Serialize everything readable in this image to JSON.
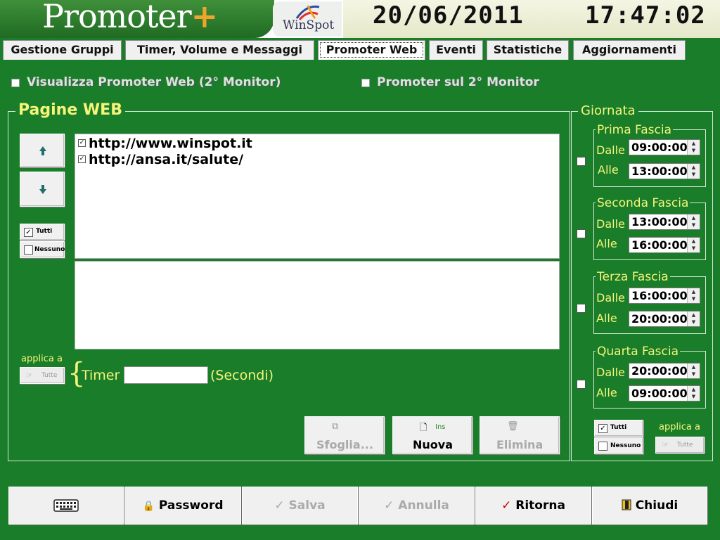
{
  "header": {
    "app_name": "Promoter",
    "app_name_plus": "+",
    "brand": "WinSpot",
    "date": "20/06/2011",
    "time": "17:47:02"
  },
  "tabs": [
    {
      "label": "Gestione Gruppi",
      "active": false
    },
    {
      "label": "Timer, Volume e Messaggi",
      "active": false
    },
    {
      "label": "Promoter Web",
      "active": true
    },
    {
      "label": "Eventi",
      "active": false
    },
    {
      "label": "Statistiche",
      "active": false
    },
    {
      "label": "Aggiornamenti",
      "active": false
    }
  ],
  "options": {
    "show_web_label": "Visualizza Promoter Web (2° Monitor)",
    "promoter_second_label": "Promoter sul 2° Monitor"
  },
  "pages": {
    "title": "Pagine WEB",
    "urls": [
      {
        "url": "http://www.winspot.it",
        "checked": true
      },
      {
        "url": "http://ansa.it/salute/",
        "checked": true
      }
    ],
    "all_label": "Tutti",
    "none_label": "Nessuno",
    "apply_to_label": "applica a",
    "apply_all_label": "Tutte",
    "timer_label": "Timer",
    "timer_value": "",
    "timer_unit": "(Secondi)",
    "browse_label": "Sfoglia...",
    "new_label": "Nuova",
    "new_hint": "Ins",
    "delete_label": "Elimina"
  },
  "day": {
    "title": "Giornata",
    "from_label": "Dalle",
    "to_label": "Alle",
    "slots": [
      {
        "name": "Prima Fascia",
        "from": "09:00:00",
        "to": "13:00:00"
      },
      {
        "name": "Seconda Fascia",
        "from": "13:00:00",
        "to": "16:00:00"
      },
      {
        "name": "Terza Fascia",
        "from": "16:00:00",
        "to": "20:00:00"
      },
      {
        "name": "Quarta Fascia",
        "from": "20:00:00",
        "to": "09:00:00"
      }
    ],
    "all_label": "Tutti",
    "none_label": "Nessuno",
    "apply_to_label": "applica a",
    "apply_all_label": "Tutte"
  },
  "bottom_bar": {
    "password_label": "Password",
    "save_label": "Salva",
    "cancel_label": "Annulla",
    "return_label": "Ritorna",
    "close_label": "Chiudi"
  },
  "colors": {
    "background": "#1a7d2a",
    "label_yellow": "#f6f57a",
    "check_red": "#d00000"
  }
}
